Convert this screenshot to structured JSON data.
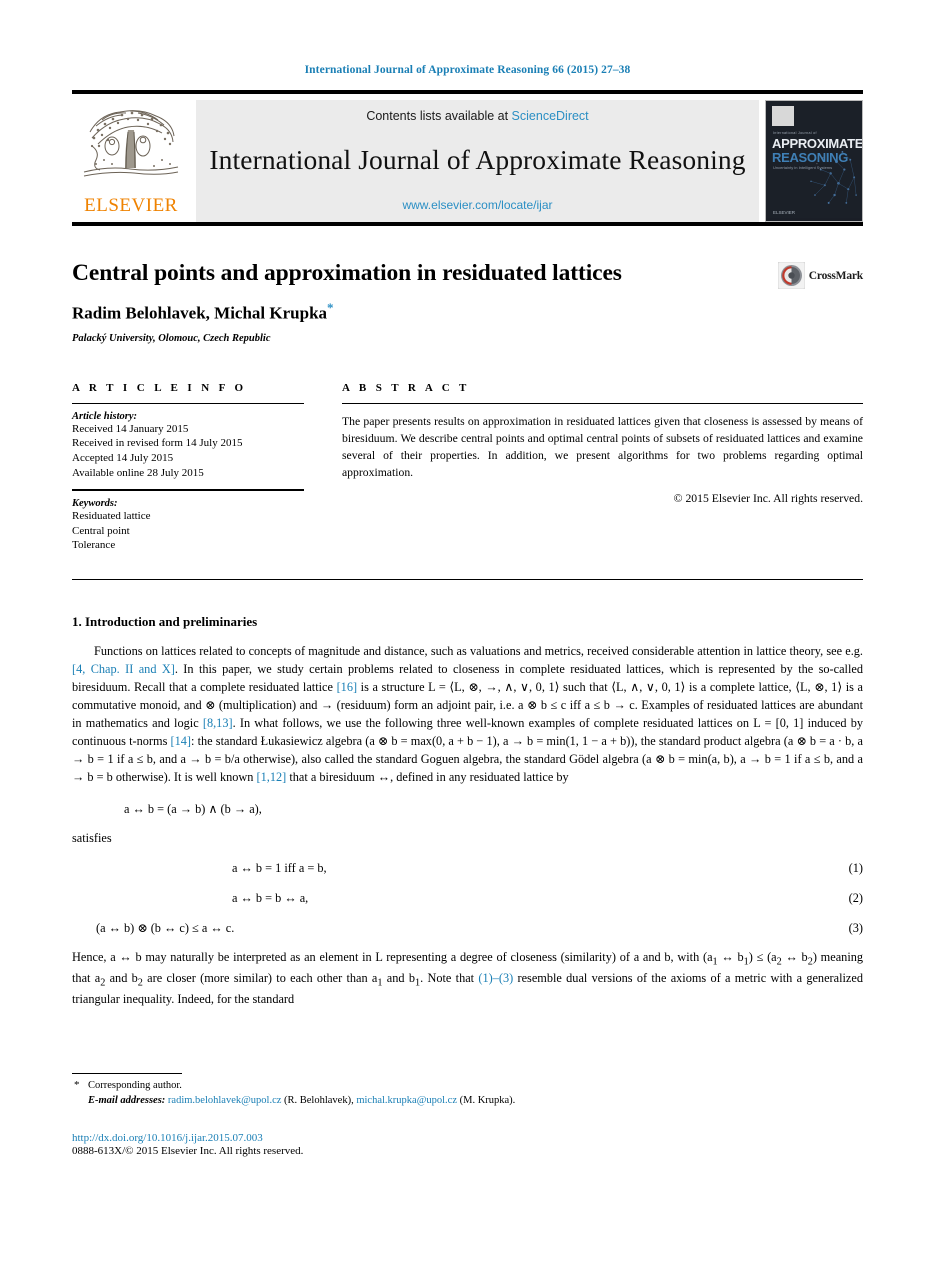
{
  "running_head": "International Journal of Approximate Reasoning 66 (2015) 27–38",
  "masthead": {
    "publisher_name": "ELSEVIER",
    "contents_prefix": "Contents lists available at ",
    "contents_link": "ScienceDirect",
    "journal_title": "International Journal of Approximate Reasoning",
    "journal_url": "www.elsevier.com/locate/ijar",
    "cover": {
      "kicker": "International Journal of",
      "line1": "APPROXIMATE",
      "line2": "REASONING",
      "subtitle": "Uncertainty in Intelligent Systems",
      "footer": "ELSEVIER"
    }
  },
  "article": {
    "title": "Central points and approximation in residuated lattices",
    "authors": "Radim Belohlavek, Michal Krupka",
    "corresponding_marker": "*",
    "affiliation": "Palacký University, Olomouc, Czech Republic",
    "crossmark_label": "CrossMark"
  },
  "info": {
    "label": "A R T I C L E   I N F O",
    "history_heading": "Article history:",
    "history": [
      "Received 14 January 2015",
      "Received in revised form 14 July 2015",
      "Accepted 14 July 2015",
      "Available online 28 July 2015"
    ],
    "keywords_heading": "Keywords:",
    "keywords": [
      "Residuated lattice",
      "Central point",
      "Tolerance"
    ]
  },
  "abstract": {
    "label": "A B S T R A C T",
    "text": "The paper presents results on approximation in residuated lattices given that closeness is assessed by means of biresiduum. We describe central points and optimal central points of subsets of residuated lattices and examine several of their properties. In addition, we present algorithms for two problems regarding optimal approximation.",
    "copyright": "© 2015 Elsevier Inc. All rights reserved."
  },
  "section": {
    "heading": "1. Introduction and preliminaries",
    "para1_a": "Functions on lattices related to concepts of magnitude and distance, such as valuations and metrics, received considerable attention in lattice theory, see e.g. ",
    "para1_ref1": "[4, Chap. II and X]",
    "para1_b": ". In this paper, we study certain problems related to closeness in complete residuated lattices, which is represented by the so-called biresiduum. Recall that a complete residuated lattice ",
    "para1_ref2": "[16]",
    "para1_c": " is a structure L = ⟨L, ⊗, →, ∧, ∨, 0, 1⟩ such that ⟨L, ∧, ∨, 0, 1⟩ is a complete lattice, ⟨L, ⊗, 1⟩ is a commutative monoid, and ⊗ (multiplication) and → (residuum) form an adjoint pair, i.e. a ⊗ b ≤ c iff a ≤ b → c. Examples of residuated lattices are abundant in mathematics and logic ",
    "para1_ref3": "[8,13]",
    "para1_d": ". In what follows, we use the following three well-known examples of complete residuated lattices on L = [0, 1] induced by continuous t-norms ",
    "para1_ref4": "[14]",
    "para1_e": ": the standard Łukasiewicz algebra (a ⊗ b = max(0, a + b − 1), a → b = min(1, 1 − a + b)), the standard product algebra (a ⊗ b = a · b, a → b = 1 if a ≤ b, and a → b = b/a otherwise), also called the standard Goguen algebra, the standard Gödel algebra (a ⊗ b = min(a, b), a → b = 1 if a ≤ b, and a → b = b otherwise). It is well known ",
    "para1_ref5": "[1,12]",
    "para1_f": " that a biresiduum ↔, defined in any residuated lattice by",
    "eq_def": "a ↔ b = (a → b) ∧ (b → a),",
    "satisfies": "satisfies",
    "equations": [
      {
        "body": "a ↔ b = 1     iff     a = b,",
        "num": "(1)"
      },
      {
        "body": "a ↔ b = b ↔ a,",
        "num": "(2)"
      },
      {
        "body": "(a ↔ b) ⊗ (b ↔ c) ≤ a ↔ c.",
        "num": "(3)"
      }
    ],
    "para2_a": "Hence, a ↔ b may naturally be interpreted as an element in L representing a degree of closeness (similarity) of a and b, with (a",
    "para2_sub1": "1",
    "para2_b": " ↔ b",
    "para2_sub2": "1",
    "para2_c": ") ≤ (a",
    "para2_sub3": "2",
    "para2_d": " ↔ b",
    "para2_sub4": "2",
    "para2_e": ") meaning that a",
    "para2_sub5": "2",
    "para2_f": " and b",
    "para2_sub6": "2",
    "para2_g": " are closer (more similar) to each other than a",
    "para2_sub7": "1",
    "para2_h": " and b",
    "para2_sub8": "1",
    "para2_i": ". Note that ",
    "para2_ref": "(1)–(3)",
    "para2_j": " resemble dual versions of the axioms of a metric with a generalized triangular inequality. Indeed, for the standard"
  },
  "footer": {
    "corresponding_star": "*",
    "corresponding_note": "Corresponding author.",
    "email_label": "E-mail addresses:",
    "email1": "radim.belohlavek@upol.cz",
    "email1_name": "(R. Belohlavek),",
    "email2": "michal.krupka@upol.cz",
    "email2_name": "(M. Krupka).",
    "doi": "http://dx.doi.org/10.1016/j.ijar.2015.07.003",
    "issn_line": "0888-613X/© 2015 Elsevier Inc. All rights reserved."
  },
  "colors": {
    "link": "#1a7fb5",
    "sciencedirect": "#2b8fc4",
    "elsevier_orange": "#ef8200",
    "banner_bg": "#ebebeb"
  }
}
